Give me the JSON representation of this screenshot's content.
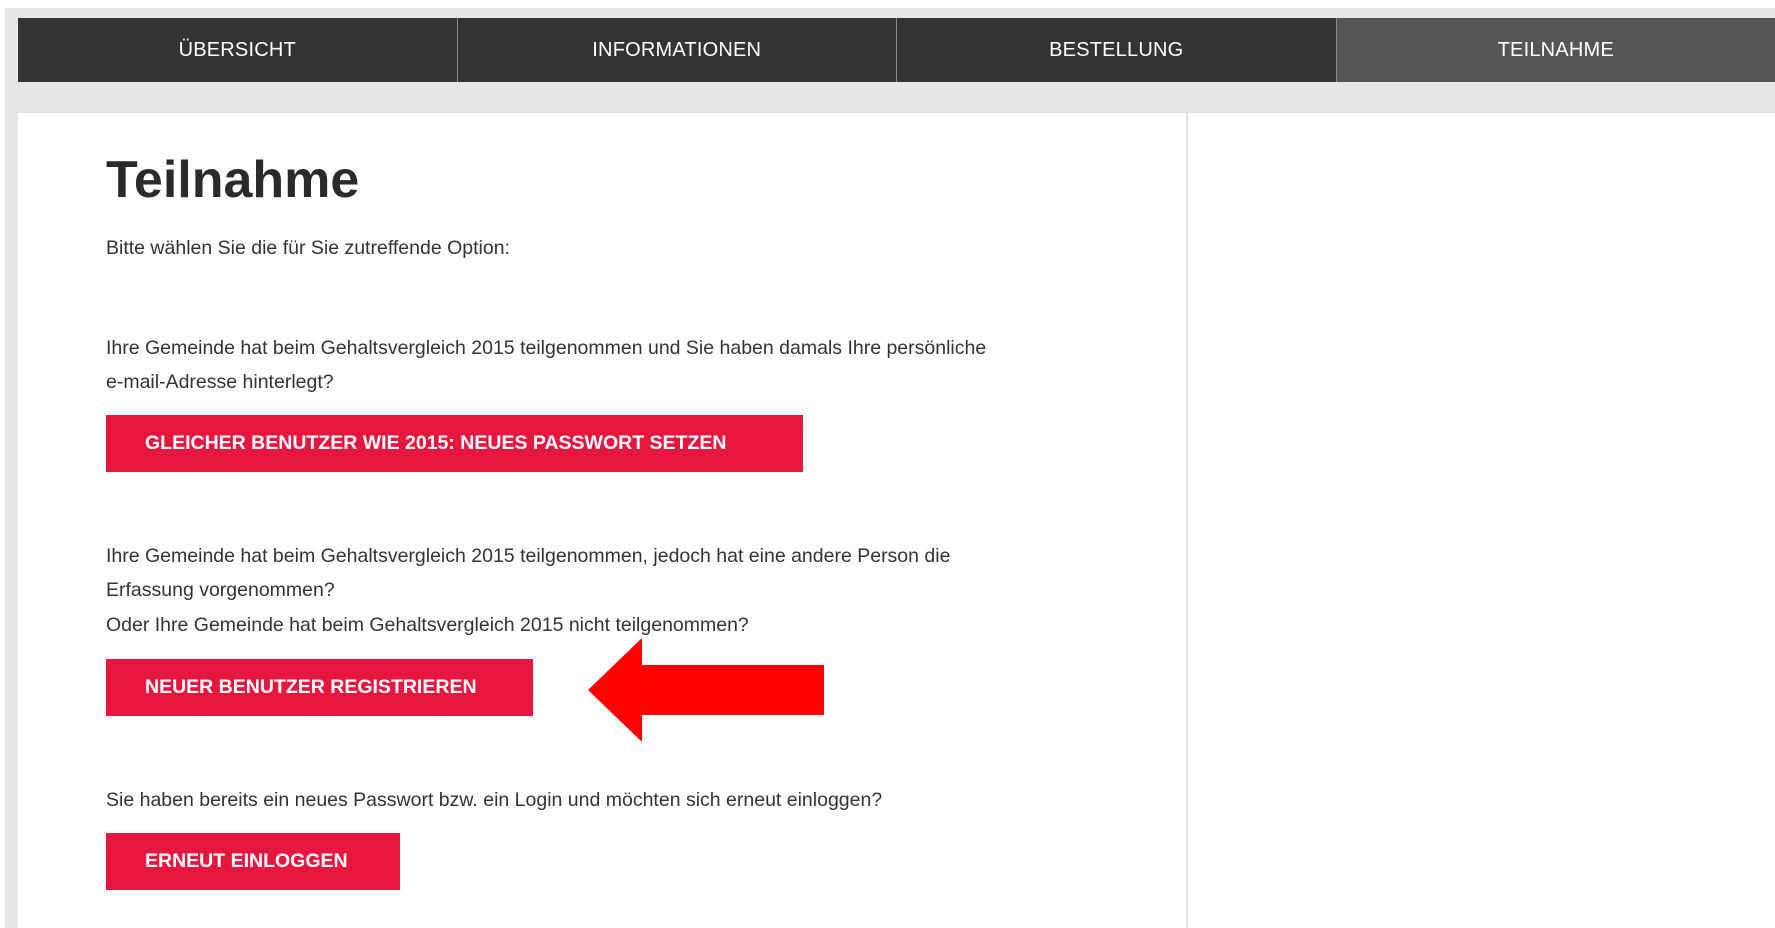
{
  "nav": {
    "items": [
      {
        "label": "ÜBERSICHT"
      },
      {
        "label": "INFORMATIONEN"
      },
      {
        "label": "BESTELLUNG"
      },
      {
        "label": "TEILNAHME"
      }
    ],
    "active_index": 3
  },
  "main": {
    "title": "Teilnahme",
    "intro": "Bitte wählen Sie die für Sie zutreffende Option:",
    "option1": {
      "line1": "Ihre Gemeinde hat beim Gehaltsvergleich 2015 teilgenommen und Sie haben damals Ihre persönliche",
      "line2": "e-mail-Adresse hinterlegt?",
      "button": "GLEICHER BENUTZER WIE 2015: NEUES PASSWORT SETZEN"
    },
    "option2": {
      "line1": "Ihre Gemeinde hat beim Gehaltsvergleich 2015 teilgenommen, jedoch hat eine andere Person die",
      "line2": "Erfassung vorgenommen?",
      "line3": "Oder Ihre Gemeinde hat beim Gehaltsvergleich 2015 nicht teilgenommen?",
      "button": "NEUER BENUTZER REGISTRIEREN"
    },
    "option3": {
      "line1": "Sie haben bereits ein neues Passwort bzw. ein Login und möchten sich erneut einloggen?",
      "button": "ERNEUT EINLOGGEN"
    }
  },
  "annotation": {
    "arrow_icon": "left-arrow-icon",
    "arrow_color": "#ff0000"
  },
  "colors": {
    "accent": "#e6173f",
    "nav_bg": "#333333",
    "nav_active_bg": "#555555",
    "page_bg": "#e6e6e6"
  }
}
